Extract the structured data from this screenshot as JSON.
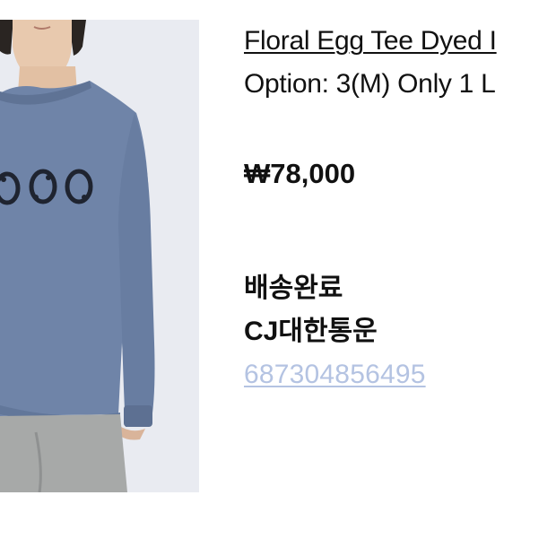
{
  "product": {
    "title": "Floral Egg Tee Dyed I",
    "option": "Option: 3(M) Only 1 L",
    "price": "₩78,000"
  },
  "shipping": {
    "status": "배송완료",
    "carrier": "CJ대한통운",
    "tracking_number": "687304856495"
  },
  "colors": {
    "tracking_link": "#b4c3e2",
    "shirt": "#6f84a8",
    "pants": "#a7a9a8",
    "photo_background": "#e9ebf1"
  }
}
